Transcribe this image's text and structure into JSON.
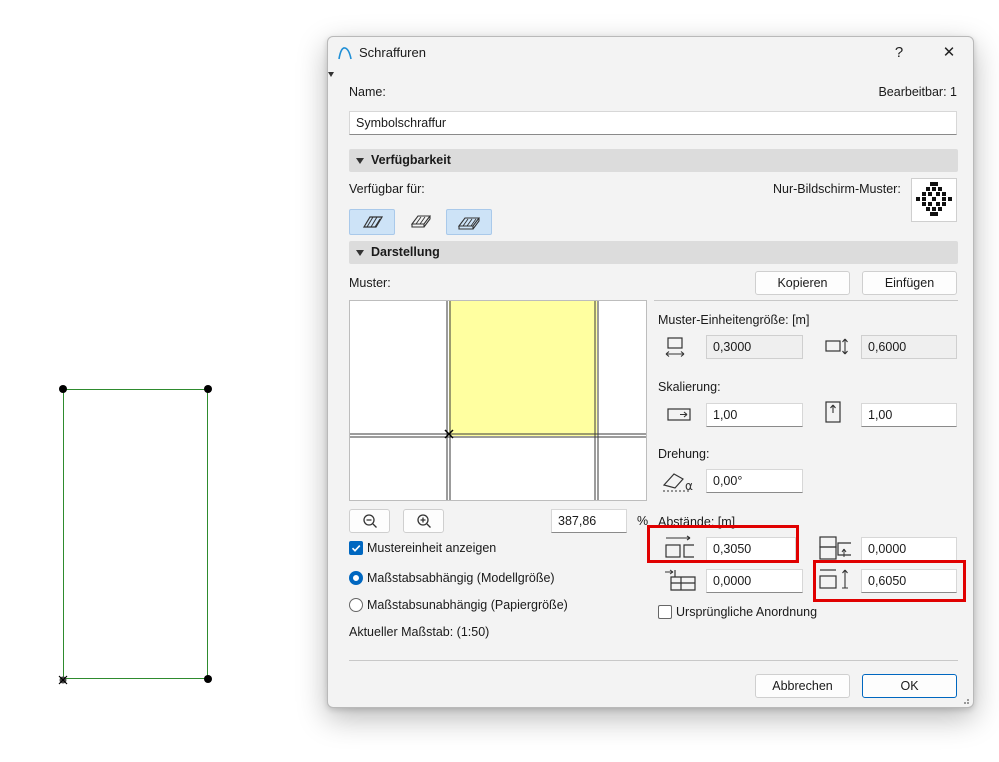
{
  "dialog": {
    "title": "Schraffuren",
    "help": "?",
    "close": "✕",
    "name_label": "Name:",
    "editable_label": "Bearbeitbar: 1",
    "name_value": "Symbolschraffur"
  },
  "availability": {
    "section_title": "Verfügbarkeit",
    "available_for_label": "Verfügbar für:",
    "screen_only_label": "Nur-Bildschirm-Muster:",
    "toggles": [
      {
        "icon": "hatch-drafting-icon",
        "on": true
      },
      {
        "icon": "hatch-cut-fill-icon",
        "on": false
      },
      {
        "icon": "hatch-cover-fill-icon",
        "on": true
      }
    ]
  },
  "display": {
    "section_title": "Darstellung",
    "pattern_label": "Muster:",
    "copy_button": "Kopieren",
    "paste_button": "Einfügen",
    "zoom_value": "387,86",
    "zoom_unit": "%",
    "show_unit_label": "Mustereinheit anzeigen",
    "show_unit_checked": true,
    "scale_dependent_label": "Maßstabsabhängig (Modellgröße)",
    "scale_independent_label": "Maßstabsunabhängig (Papiergröße)",
    "scale_dependent_selected": true,
    "current_scale_label": "Aktueller Maßstab: (1:50)",
    "unit_size_label": "Muster-Einheitengröße: [m]",
    "unit_width": "0,3000",
    "unit_height": "0,6000",
    "scaling_label": "Skalierung:",
    "scale_x": "1,00",
    "scale_y": "1,00",
    "rotation_label": "Drehung:",
    "rotation_value": "0,00°",
    "spacing_label": "Abstände: [m]",
    "spacing_h": "0,3050",
    "spacing_offset_y": "0,0000",
    "spacing_offset_x": "0,0000",
    "spacing_v": "0,6050",
    "original_arrangement_label": "Ursprüngliche Anordnung",
    "original_arrangement_checked": false
  },
  "footer": {
    "cancel_button": "Abbrechen",
    "ok_button": "OK"
  },
  "colors": {
    "accent": "#0067c0",
    "preview_fill": "#ffffa0",
    "highlight": "#e00000",
    "drawing_outline": "#2e8b2e"
  }
}
